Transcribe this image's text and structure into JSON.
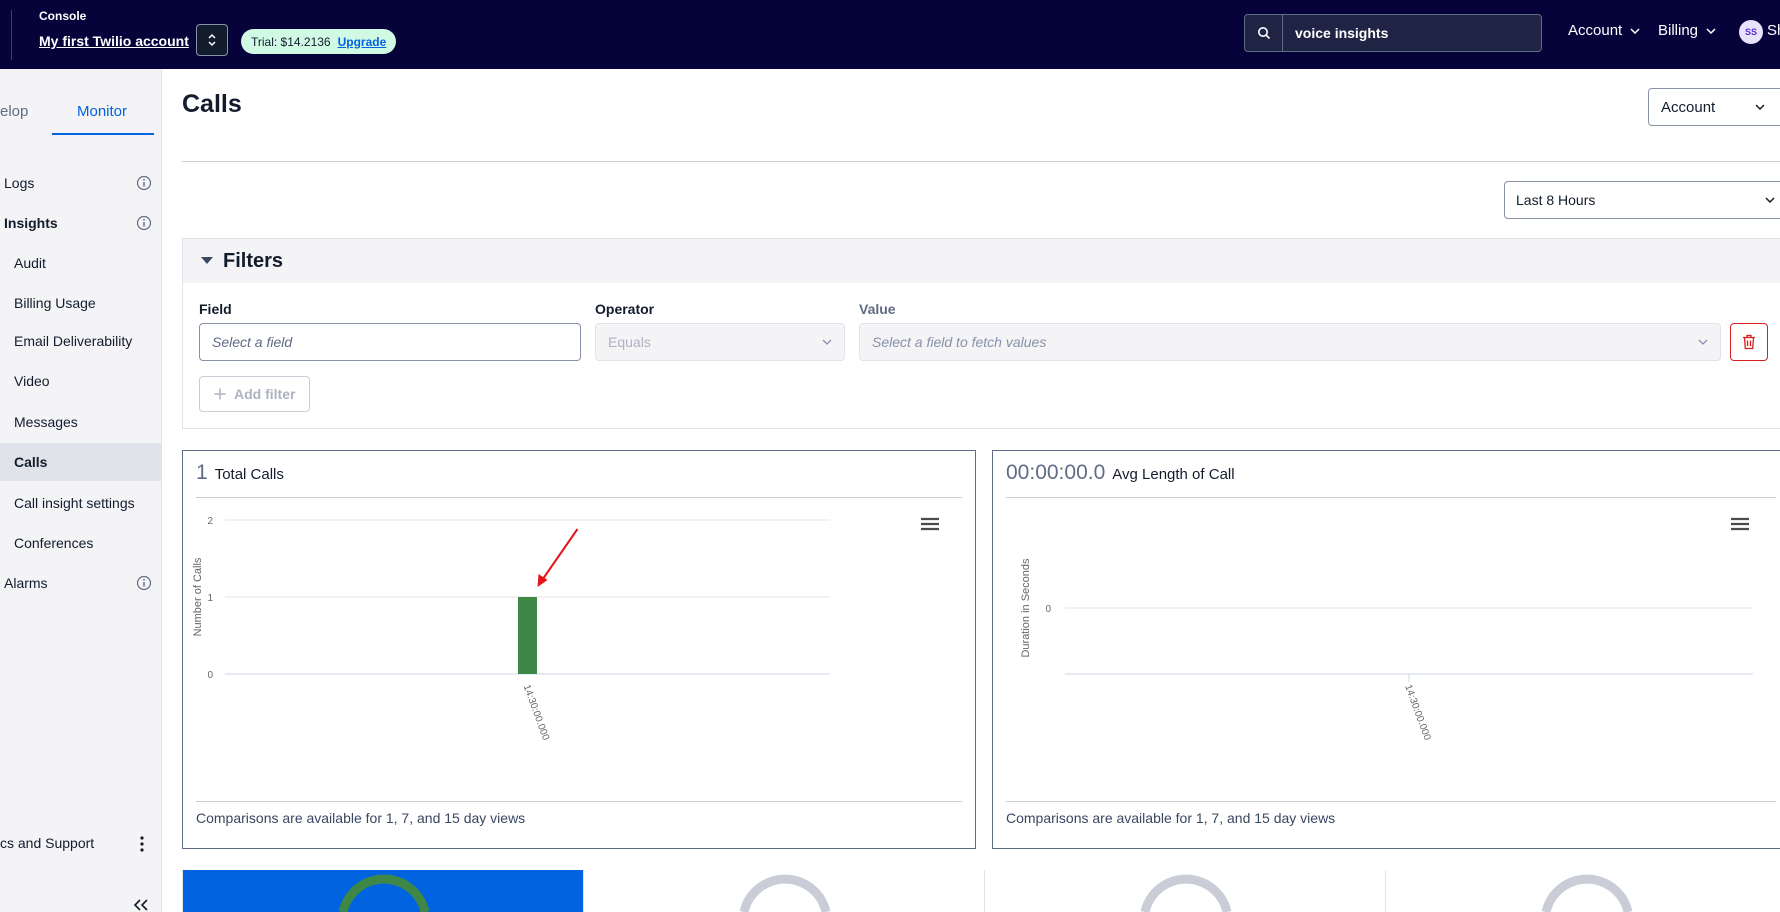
{
  "header": {
    "console_label": "Console",
    "account_name": "My first Twilio account",
    "trial_label": "Trial: $14.2136",
    "upgrade_label": "Upgrade",
    "search_value": "voice insights",
    "account_menu": "Account",
    "billing_menu": "Billing",
    "avatar_initials": "SS",
    "user_name_partial": "Sh"
  },
  "sidebar": {
    "tabs": [
      {
        "label": "elop"
      },
      {
        "label": "Monitor"
      }
    ],
    "items": [
      {
        "label": "Logs"
      },
      {
        "label": "Insights"
      },
      {
        "label": "Audit"
      },
      {
        "label": "Billing Usage"
      },
      {
        "label": "Email Deliverability"
      },
      {
        "label": "Video"
      },
      {
        "label": "Messages"
      },
      {
        "label": "Calls"
      },
      {
        "label": "Call insight settings"
      },
      {
        "label": "Conferences"
      },
      {
        "label": "Alarms"
      }
    ],
    "footer_label": "cs and Support"
  },
  "main": {
    "title": "Calls",
    "account_select": "Account",
    "time_range": "Last 8 Hours"
  },
  "filters": {
    "title": "Filters",
    "field_label": "Field",
    "field_placeholder": "Select a field",
    "operator_label": "Operator",
    "operator_value": "Equals",
    "value_label": "Value",
    "value_placeholder": "Select a field to fetch values",
    "add_filter_label": "Add filter"
  },
  "cards": [
    {
      "big_value": "1",
      "label": "Total Calls",
      "footer": "Comparisons are available for 1, 7, and 15 day views"
    },
    {
      "big_value": "00:00:00.0",
      "label": "Avg Length of Call",
      "footer": "Comparisons are available for 1, 7, and 15 day views"
    }
  ],
  "chart_data": [
    {
      "type": "bar",
      "title": "Total Calls",
      "ylabel": "Number of Calls",
      "categories": [
        "14:30:00.000"
      ],
      "values": [
        1
      ],
      "yticks": [
        "0",
        "1",
        "2"
      ],
      "ylim": [
        0,
        2
      ],
      "color": "#3f8746",
      "annotation_color": "#e5141b"
    },
    {
      "type": "bar",
      "title": "Avg Length of Call",
      "ylabel": "Duration in Seconds",
      "categories": [
        "14:30:00.000"
      ],
      "values": [],
      "yticks": [
        "0"
      ]
    }
  ],
  "colors": {
    "topbar": "#06033a",
    "accent": "#0263e0",
    "danger": "#d61f1f",
    "bar": "#3f8746"
  }
}
